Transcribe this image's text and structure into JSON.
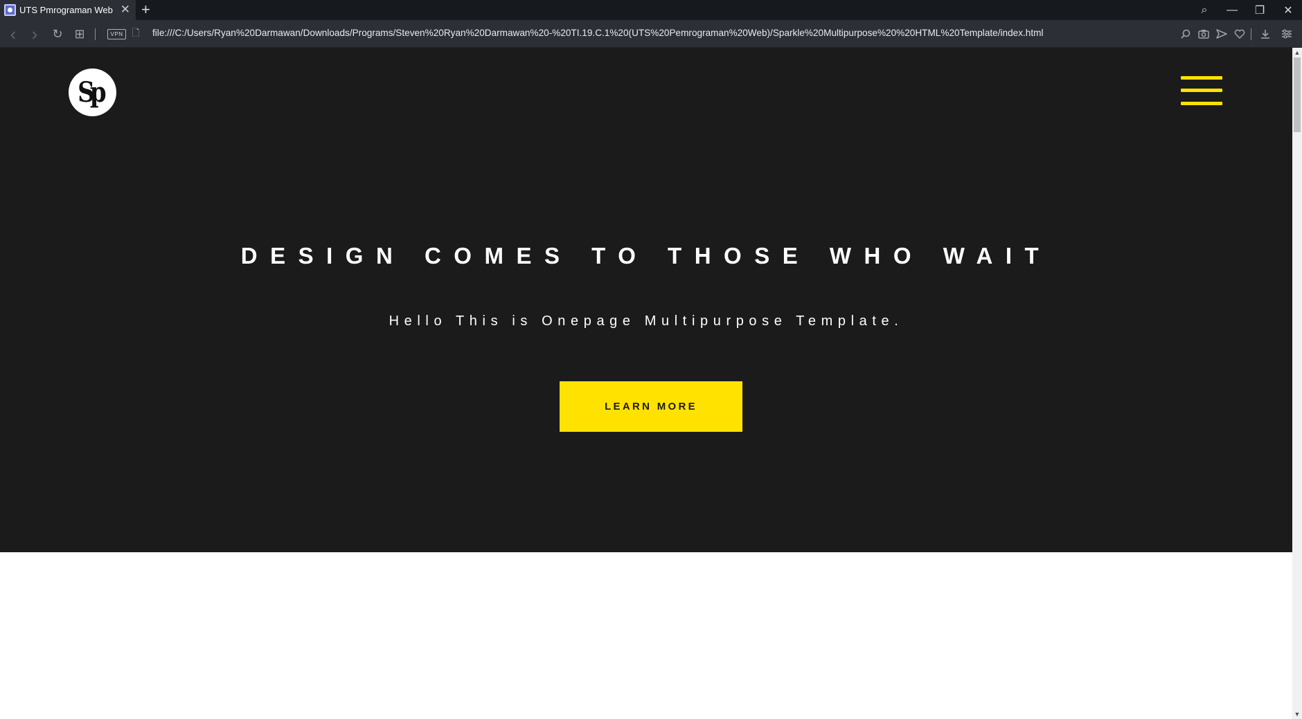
{
  "browser": {
    "tab": {
      "title": "UTS Pmrograman Web",
      "close_glyph": "✕",
      "favicon": "page-favicon"
    },
    "new_tab_glyph": "+",
    "window_controls": {
      "search": "⌕",
      "minimize": "—",
      "restore": "❐",
      "close": "✕"
    },
    "nav": {
      "back": "‹",
      "forward": "›",
      "reload": "↻",
      "tabs_grid": "⊞",
      "vpn": "VPN",
      "page_icon": "🗋"
    },
    "url": "file:///C:/Users/Ryan%20Darmawan/Downloads/Programs/Steven%20Ryan%20Darmawan%20-%20TI.19.C.1%20(UTS%20Pemrograman%20Web)/Sparkle%20Multipurpose%20%20HTML%20Template/index.html",
    "right_icons": [
      "zoom-icon",
      "camera-icon",
      "send-icon",
      "heart-icon",
      "download-icon",
      "easy-setup-icon"
    ]
  },
  "site": {
    "logo_text": "Sp",
    "hero": {
      "title": "DESIGN COMES TO THOSE WHO WAIT",
      "subtitle": "Hello This is Onepage Multipurpose Template.",
      "cta_label": "LEARN MORE"
    },
    "colors": {
      "hero_bg": "#1b1b1b",
      "accent": "#ffe200",
      "text": "#ffffff"
    }
  },
  "scrollbar": {
    "up": "▲",
    "down": "▼",
    "position": 0
  }
}
